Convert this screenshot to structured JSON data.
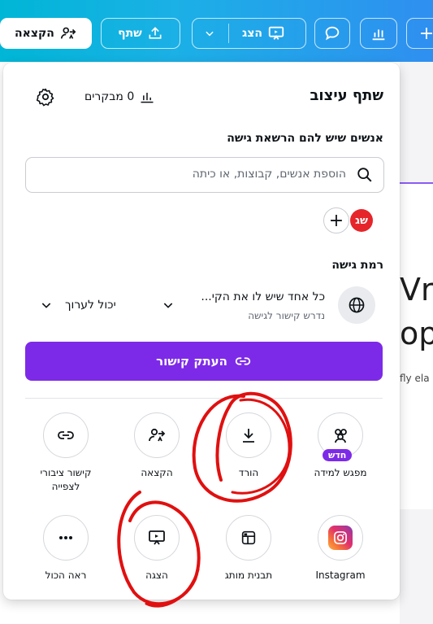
{
  "topbar": {
    "share_label": "שתף",
    "present_label": "הצג",
    "assign_label": "הקצאה",
    "plus_label": "+"
  },
  "panel": {
    "title": "שתף עיצוב",
    "visitors": "0 מבקרים",
    "people_heading": "אנשים שיש להם הרשאת גישה",
    "search_placeholder": "הוספת אנשים, קבוצות, או כיתה",
    "avatar_initials": "שג",
    "access_heading": "רמת גישה",
    "access_value": "כל אחד שיש לו את הקי...",
    "access_sub": "נדרש קישור לגישה",
    "permission_value": "יכול לערוך",
    "copy_link_label": "העתק קישור"
  },
  "options": [
    {
      "label": "מפגש למידה",
      "badge": "חדש",
      "icon": "people-icon"
    },
    {
      "label": "הורד",
      "icon": "download-icon"
    },
    {
      "label": "הקצאה",
      "icon": "assign-icon"
    },
    {
      "label": "קישור ציבורי לצפייה",
      "icon": "link-icon"
    },
    {
      "label": "Instagram",
      "icon": "instagram-icon"
    },
    {
      "label": "תבנית מותג",
      "icon": "brand-template-icon"
    },
    {
      "label": "הצגה",
      "icon": "present-icon"
    },
    {
      "label": "ראה הכול",
      "icon": "more-icon"
    }
  ],
  "background": {
    "text_1": "Vri",
    "text_2": "op",
    "text_3": "fly ela"
  },
  "colors": {
    "brand_purple": "#7d2ae8",
    "topbar_start": "#00b6d6",
    "topbar_end": "#2f8ff0",
    "avatar_red": "#e5252a",
    "annotation_red": "#e01010"
  }
}
